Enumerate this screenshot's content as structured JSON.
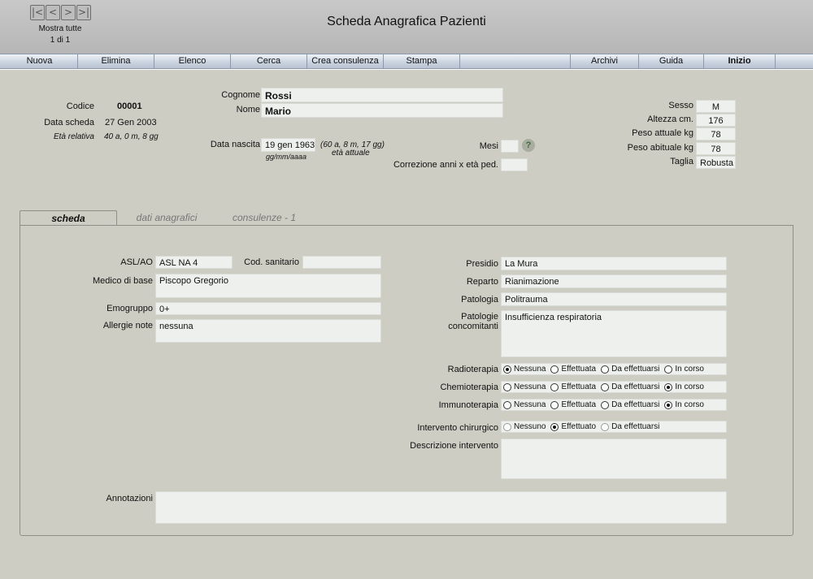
{
  "header": {
    "title": "Scheda Anagrafica Pazienti",
    "nav": {
      "first": "|<",
      "prev": "<",
      "next": ">",
      "last": ">|"
    },
    "show_all": "Mostra tutte",
    "record_count": "1 di 1"
  },
  "toolbar": {
    "nuova": "Nuova",
    "elimina": "Elimina",
    "elenco": "Elenco",
    "cerca": "Cerca",
    "crea_consulenza": "Crea consulenza",
    "stampa": "Stampa",
    "archivi": "Archivi",
    "guida": "Guida",
    "inizio": "Inizio"
  },
  "record": {
    "codice_label": "Codice",
    "codice": "00001",
    "data_scheda_label": "Data scheda",
    "data_scheda": "27 Gen 2003",
    "eta_relativa_label": "Età relativa",
    "eta_relativa": "40 a, 0 m, 8 gg"
  },
  "patient": {
    "cognome_label": "Cognome",
    "cognome": "Rossi",
    "nome_label": "Nome",
    "nome": "Mario",
    "data_nascita_label": "Data nascita",
    "data_nascita": "19 gen 1963",
    "date_format": "gg/mm/aaaa",
    "eta_attuale": "(60 a, 8 m, 17 gg)",
    "eta_attuale_label": "età attuale",
    "mesi_label": "Mesi",
    "mesi": "",
    "help_icon": "?",
    "correzione_label": "Correzione anni x età ped.",
    "correzione": ""
  },
  "physical": {
    "sesso_label": "Sesso",
    "sesso": "M",
    "altezza_label": "Altezza cm.",
    "altezza": "176",
    "peso_attuale_label": "Peso attuale kg",
    "peso_attuale": "78",
    "peso_abituale_label": "Peso abituale kg",
    "peso_abituale": "78",
    "taglia_label": "Taglia",
    "taglia": "Robusta"
  },
  "tabs": {
    "scheda": "scheda",
    "dati_anagrafici": "dati anagrafici",
    "consulenze": "consulenze - 1"
  },
  "scheda": {
    "asl_label": "ASL/AO",
    "asl": "ASL NA 4",
    "cod_sanitario_label": "Cod. sanitario",
    "cod_sanitario": "",
    "medico_label": "Medico di base",
    "medico": "Piscopo Gregorio",
    "emogruppo_label": "Emogruppo",
    "emogruppo": "0+",
    "allergie_label": "Allergie note",
    "allergie": "nessuna",
    "presidio_label": "Presidio",
    "presidio": "La Mura",
    "reparto_label": "Reparto",
    "reparto": "Rianimazione",
    "patologia_label": "Patologia",
    "patologia": "Politrauma",
    "patologie_conc_label_1": "Patologie",
    "patologie_conc_label_2": "concomitanti",
    "patologie_conc": "Insufficienza respiratoria",
    "therapy_options": [
      "Nessuna",
      "Effettuata",
      "Da effettuarsi",
      "In corso"
    ],
    "radioterapia_label": "Radioterapia",
    "radioterapia_selected": 0,
    "chemioterapia_label": "Chemioterapia",
    "chemioterapia_selected": 3,
    "immunoterapia_label": "Immunoterapia",
    "immunoterapia_selected": 3,
    "intervento_label": "Intervento chirurgico",
    "intervento_options": [
      "Nessuno",
      "Effettuato",
      "Da effettuarsi"
    ],
    "intervento_selected": 1,
    "descrizione_label": "Descrizione intervento",
    "descrizione": "",
    "annotazioni_label": "Annotazioni",
    "annotazioni": ""
  }
}
